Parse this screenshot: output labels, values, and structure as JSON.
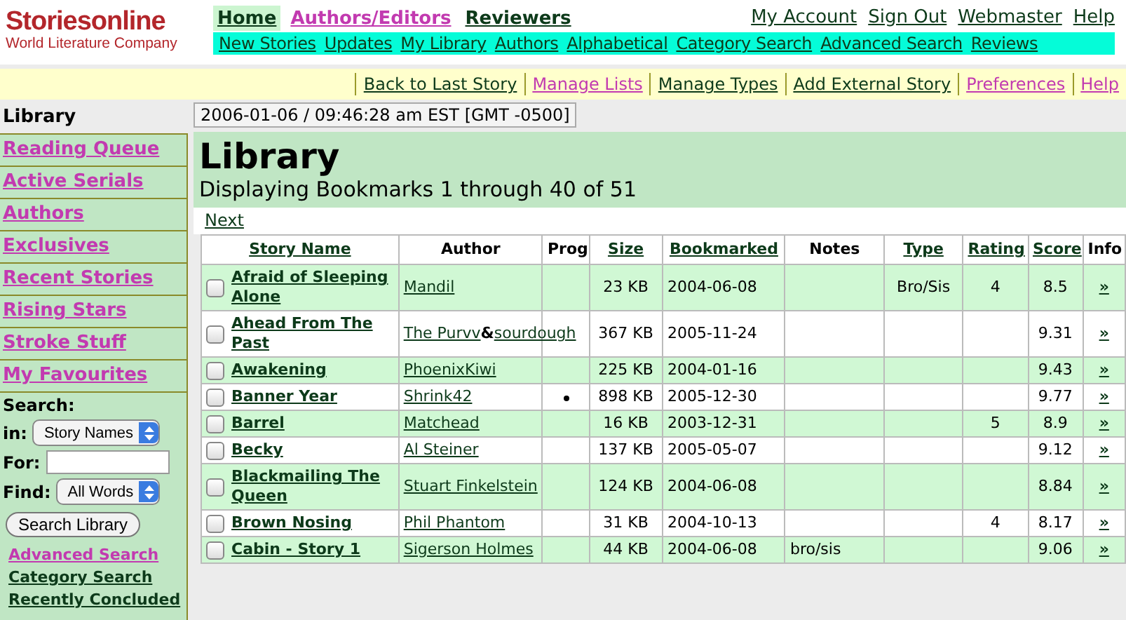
{
  "logo": {
    "name": "Storiesonline",
    "tagline": "World Literature Company"
  },
  "nav_top": [
    {
      "label": "Home",
      "selected": true,
      "visited": false
    },
    {
      "label": "Authors/Editors",
      "selected": false,
      "visited": true
    },
    {
      "label": "Reviewers",
      "selected": false,
      "visited": false
    }
  ],
  "account_links": [
    {
      "label": "My Account",
      "visited": false
    },
    {
      "label": "Sign Out",
      "visited": false
    },
    {
      "label": "Webmaster",
      "visited": false
    },
    {
      "label": "Help",
      "visited": false
    }
  ],
  "nav_bar": [
    {
      "label": "New Stories",
      "visited": false
    },
    {
      "label": "Updates",
      "visited": false
    },
    {
      "label": "My Library",
      "visited": false
    },
    {
      "label": "Authors",
      "visited": false
    },
    {
      "label": "Alphabetical",
      "visited": false
    },
    {
      "label": "Category Search",
      "visited": false
    },
    {
      "label": "Advanced Search",
      "visited": false
    },
    {
      "label": "Reviews",
      "visited": false
    }
  ],
  "toolbar": [
    {
      "label": "Back to Last Story",
      "visited": false
    },
    {
      "label": "Manage Lists",
      "visited": true
    },
    {
      "label": "Manage Types",
      "visited": false
    },
    {
      "label": "Add External Story",
      "visited": false
    },
    {
      "label": "Preferences",
      "visited": true
    },
    {
      "label": "Help",
      "visited": true
    }
  ],
  "sidebar": {
    "title": "Library",
    "items": [
      {
        "label": "Reading Queue"
      },
      {
        "label": "Active Serials"
      },
      {
        "label": "Authors"
      },
      {
        "label": "Exclusives"
      },
      {
        "label": "Recent Stories"
      },
      {
        "label": "Rising Stars"
      },
      {
        "label": "Stroke Stuff"
      },
      {
        "label": "My Favourites"
      }
    ],
    "search": {
      "title": "Search:",
      "in_label": "in:",
      "in_value": "Story Names",
      "for_label": "For:",
      "find_label": "Find:",
      "find_value": "All Words",
      "button": "Search Library"
    },
    "links": [
      {
        "label": "Advanced Search",
        "visited": true
      },
      {
        "label": "Category Search",
        "visited": false
      },
      {
        "label": "Recently Concluded",
        "visited": false
      }
    ]
  },
  "timestamp": "2006-01-06 / 09:46:28 am EST [GMT -0500]",
  "heading": "Library",
  "subheading": "Displaying Bookmarks 1 through 40 of 51",
  "next_link": "Next",
  "table": {
    "columns": [
      {
        "label": "Story Name",
        "sortable": true
      },
      {
        "label": "Author",
        "sortable": false
      },
      {
        "label": "Prog",
        "sortable": false
      },
      {
        "label": "Size",
        "sortable": true
      },
      {
        "label": "Bookmarked",
        "sortable": true
      },
      {
        "label": "Notes",
        "sortable": false
      },
      {
        "label": "Type",
        "sortable": true
      },
      {
        "label": "Rating",
        "sortable": true
      },
      {
        "label": "Score",
        "sortable": true
      },
      {
        "label": "Info",
        "sortable": false
      }
    ],
    "rows": [
      {
        "checked": false,
        "story": "Afraid of Sleeping Alone",
        "authors": [
          "Mandil"
        ],
        "in_progress": false,
        "size": "23 KB",
        "bookmarked": "2004-06-08",
        "type": "Bro/Sis",
        "rating": "4",
        "score": "8.5",
        "info": "»"
      },
      {
        "checked": false,
        "story": "Ahead From The Past",
        "authors": [
          "The Purvv",
          "sourdough"
        ],
        "joiner": "&",
        "in_progress": false,
        "size": "367 KB",
        "bookmarked": "2005-11-24",
        "score": "9.31",
        "info": "»"
      },
      {
        "checked": false,
        "story": "Awakening",
        "authors": [
          "PhoenixKiwi"
        ],
        "in_progress": false,
        "size": "225 KB",
        "bookmarked": "2004-01-16",
        "score": "9.43",
        "info": "»"
      },
      {
        "checked": false,
        "story": "Banner Year",
        "authors": [
          "Shrink42"
        ],
        "in_progress": true,
        "size": "898 KB",
        "bookmarked": "2005-12-30",
        "score": "9.77",
        "info": "»"
      },
      {
        "checked": false,
        "story": "Barrel",
        "authors": [
          "Matchead"
        ],
        "in_progress": false,
        "size": "16 KB",
        "bookmarked": "2003-12-31",
        "rating": "5",
        "score": "8.9",
        "info": "»"
      },
      {
        "checked": false,
        "story": "Becky",
        "authors": [
          "Al Steiner"
        ],
        "in_progress": false,
        "size": "137 KB",
        "bookmarked": "2005-05-07",
        "score": "9.12",
        "info": "»"
      },
      {
        "checked": false,
        "story": "Blackmailing The Queen",
        "authors": [
          "Stuart Finkelstein"
        ],
        "in_progress": false,
        "size": "124 KB",
        "bookmarked": "2004-06-08",
        "score": "8.84",
        "info": "»"
      },
      {
        "checked": false,
        "story": "Brown Nosing",
        "authors": [
          "Phil Phantom"
        ],
        "in_progress": false,
        "size": "31 KB",
        "bookmarked": "2004-10-13",
        "rating": "4",
        "score": "8.17",
        "info": "»"
      },
      {
        "checked": false,
        "story": "Cabin - Story 1",
        "authors": [
          "Sigerson Holmes"
        ],
        "in_progress": false,
        "size": "44 KB",
        "bookmarked": "2004-06-08",
        "notes": "bro/sis",
        "score": "9.06",
        "info": "»"
      }
    ]
  }
}
